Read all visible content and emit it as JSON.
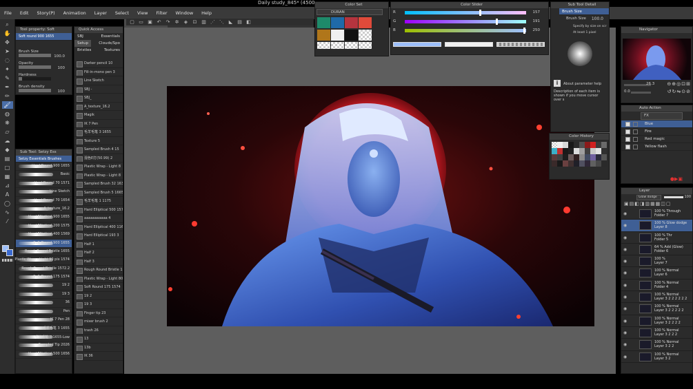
{
  "document_title": "Daily study_845* (4500",
  "menu": [
    "File",
    "Edit",
    "Story(P)",
    "Animation",
    "Layer",
    "Select",
    "View",
    "Filter",
    "Window",
    "Help"
  ],
  "canvas_tab": "Daily study_845*",
  "tool_property": {
    "title": "Tool property: Soft",
    "brush_name": "Soft round 900 1655",
    "sliders": [
      {
        "label": "Brush Size",
        "value": "100.0",
        "fill": 1.0
      },
      {
        "label": "Opacity",
        "value": "100",
        "fill": 1.0
      },
      {
        "label": "Hardness",
        "value": "",
        "fill": 0.1
      },
      {
        "label": "Brush density",
        "value": "100",
        "fill": 1.0
      }
    ]
  },
  "quick_access": {
    "title": "Quick Access",
    "tabs_left": [
      "SBJ",
      "Setup",
      "Bristles"
    ],
    "tabs_right": [
      "Essentials",
      "Clouds/Spo",
      "Textures"
    ],
    "items": [
      "Darker pencil 10",
      "Fill-in-mono pen 3",
      "Line Sketch",
      "SBJ -",
      "SBJ_",
      "A_texture_16.2",
      "Magik",
      "IK 7 Pen",
      "毛羊毛笔 3 1655",
      "Texture 5",
      "Sampled Brush 4 15",
      "混色E打(50.99) 2",
      "Plastic Wrap - Light 8",
      "Plastic Wrap - Light 8",
      "Sampled Brush 32 1630",
      "Sampled Brush 5 1665",
      "毛羊毛笔 1 1175",
      "Hard Elliptical 500 1575",
      "aaaaaaaaaaa 4",
      "Hard Elliptical 400 1160 4",
      "Hard Elliptical 193 3",
      "Half 1",
      "Half 2",
      "Half 3",
      "Rough Round Bristle 15",
      "Plastic Wrap - Light 80",
      "Soft Round 175 1574",
      "19 2",
      "19 3",
      "Finger tip 23",
      "mixer brush 2",
      "trash 26",
      "13",
      "13b",
      "IK 36"
    ]
  },
  "sub_tool": {
    "title": "Sub Tool: Setzy Ess",
    "group": "Setzy Essentials Brushes",
    "brushes": [
      "Hard Round 900 1655",
      "Basic",
      "Hard Round 70 1571",
      "Line Sketch",
      "Hard Round 70 1654",
      "A_texture_16.2",
      "Hard Elliptical 900 1655",
      "Hard Elliptical 200 1575",
      "Hard Elliptical 400 1569",
      "Soft Round 900 1655",
      "Rough Round Bristle 1655",
      "Plastic Wrap - Light 90 pix 1574",
      "Rough Round Bristle 1572.2",
      "Soft Round 175 1574",
      "19 2",
      "19 3",
      "36",
      "Pen",
      "IK 7 Pen 28",
      "毛羊毛笔 3 1655",
      "毛羊毛笔 3 1655-Low",
      "Sampled Tip 2026",
      "Hard Elliptical 500 1656"
    ],
    "selected_index": 9
  },
  "color_set": {
    "title": "Color Set",
    "set_name": "DURAN",
    "colors": [
      "#1e8a6a",
      "#1f6aa8",
      "#b5343e",
      "#e04a3a",
      "#b0761a",
      "#f0f0f0",
      "#101010",
      "checker"
    ]
  },
  "color_slider": {
    "title": "Color Slider",
    "channels": [
      {
        "label": "R",
        "value": "157",
        "fill": 0.615,
        "color": "#e070c0"
      },
      {
        "label": "G",
        "value": "191",
        "fill": 0.749,
        "color": "#50c070"
      },
      {
        "label": "B",
        "value": "250",
        "fill": 0.98,
        "color": "#c0a020"
      }
    ],
    "current_color": "#9dbffa"
  },
  "sub_tool_detail": {
    "title": "Sub Tool Detail",
    "section": "Brush Size",
    "field_label": "Brush Size",
    "field_value": "100.0",
    "opt1": "Specify by size on scr",
    "opt2": "At least 1 pixel",
    "help_title": "About parameter help",
    "help_text": "Description of each item is shown if you move cursor over s"
  },
  "color_history": {
    "title": "Color History",
    "colors": [
      "checker",
      "#f0f0f0",
      "#d8d8d8",
      "#181818",
      "#2a2a2a",
      "#505050",
      "#8b1a1a",
      "#d02020",
      "#3a3a3a",
      "#6a6a6a",
      "#3bb0c8",
      "#c03030",
      "#1a1a1a",
      "#202020",
      "#dcdcdc",
      "#a0a0a0",
      "#404040",
      "#c8c8c8",
      "#e0e0e0",
      "#303030",
      "#5a3a3a",
      "#404040",
      "#1e1e1e",
      "#6a5a5a",
      "#302020",
      "#8a8a8a",
      "#404a60",
      "#7060a0",
      "#2a2a3a",
      "#555555",
      "#3a2a2a",
      "#1a1a1a",
      "#6a4040",
      "#403030",
      "#202028",
      "#505060",
      "#302838",
      "#606060",
      "#484848",
      "#2a2a2a"
    ]
  },
  "navigator": {
    "title": "Navigator",
    "zoom": "26.3",
    "rotation": "0.0"
  },
  "auto_action": {
    "title": "Auto Action",
    "set": "FX",
    "items": [
      {
        "name": "Blue",
        "selected": true
      },
      {
        "name": "Fire",
        "selected": false
      },
      {
        "name": "Red magic",
        "selected": false
      },
      {
        "name": "Yellow flash",
        "selected": false
      }
    ]
  },
  "layer": {
    "title": "Layer",
    "blend_mode": "Glow dodge",
    "opacity": "100",
    "layers": [
      {
        "line1": "100 % Through",
        "line2": "Folder 7",
        "selected": false
      },
      {
        "line1": "100 % Glow dodge",
        "line2": "Layer 8",
        "selected": true
      },
      {
        "line1": "100 % Thr",
        "line2": "Folder 5",
        "selected": false
      },
      {
        "line1": "64 % Add (Glow)",
        "line2": "Folder 6",
        "selected": false
      },
      {
        "line1": "100 %",
        "line2": "Layer 7",
        "selected": false
      },
      {
        "line1": "100 % Normal",
        "line2": "Layer 6",
        "selected": false
      },
      {
        "line1": "100 % Normal",
        "line2": "Folder 4",
        "selected": false
      },
      {
        "line1": "100 % Normal",
        "line2": "Layer 3 2 2 2 2 2 2",
        "selected": false
      },
      {
        "line1": "100 % Normal",
        "line2": "Layer 3 2 2 2 2 2",
        "selected": false
      },
      {
        "line1": "100 % Normal",
        "line2": "Layer 3 2 2 2 2",
        "selected": false
      },
      {
        "line1": "100 % Normal",
        "line2": "Layer 3 2 2 2",
        "selected": false
      },
      {
        "line1": "100 % Normal",
        "line2": "Layer 3 2 2",
        "selected": false
      },
      {
        "line1": "100 % Normal",
        "line2": "Layer 3 2",
        "selected": false
      }
    ]
  }
}
